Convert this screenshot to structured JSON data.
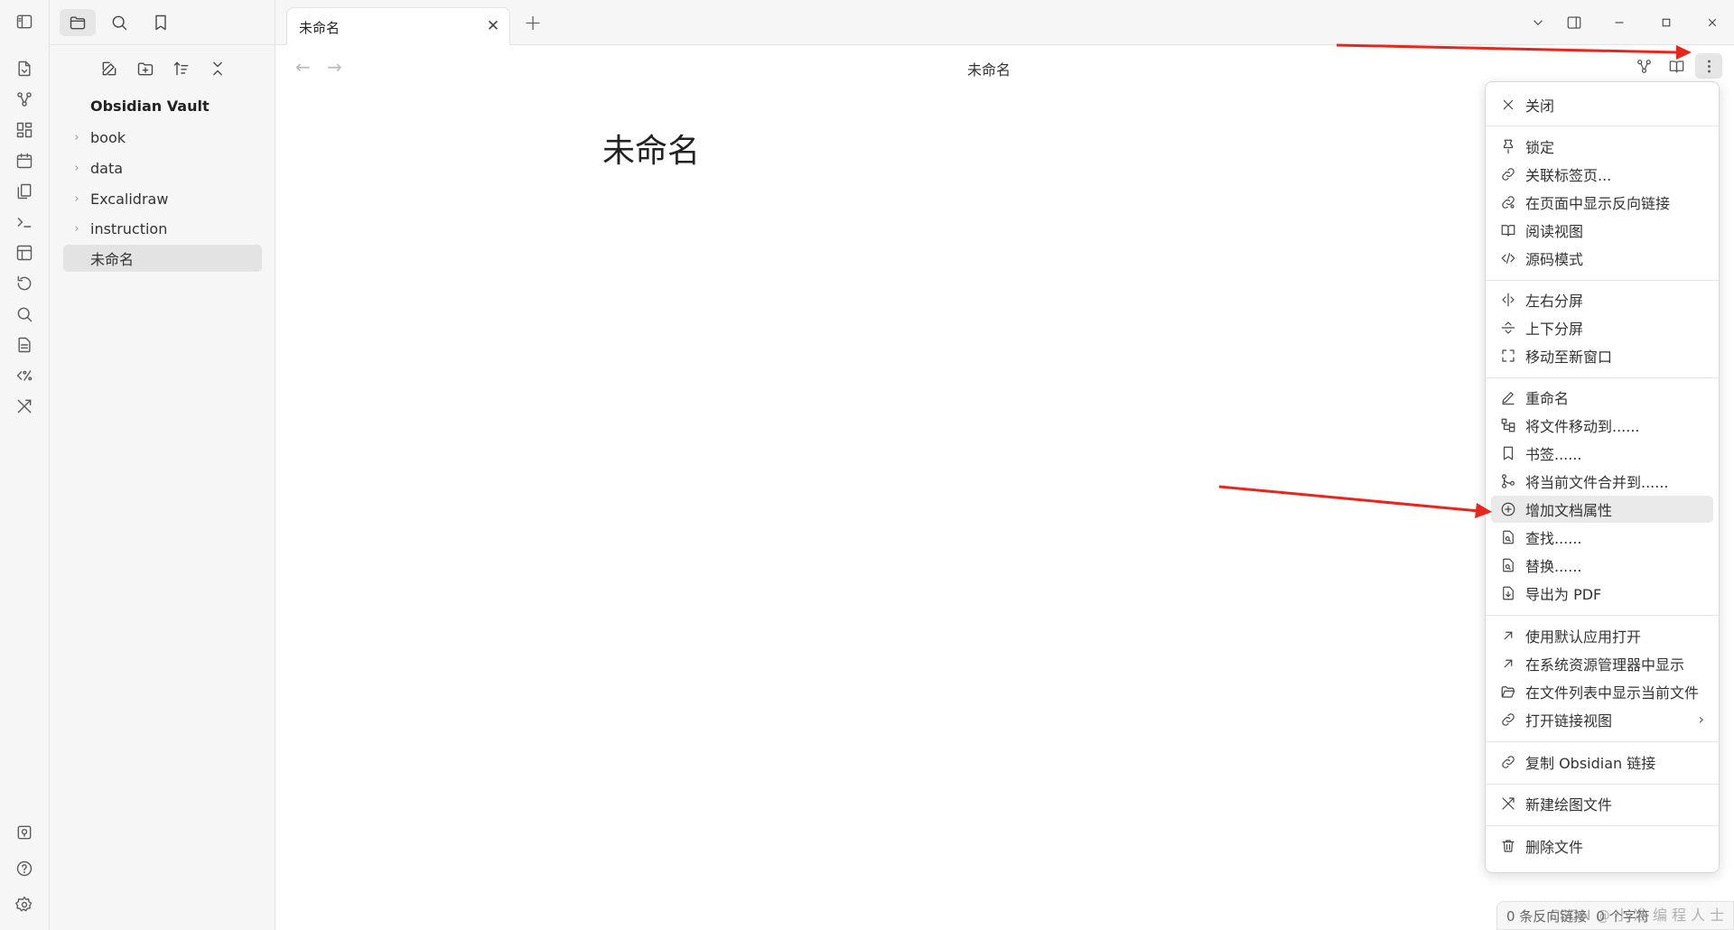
{
  "sidebar": {
    "vault_name": "Obsidian Vault",
    "tree": [
      {
        "label": "book",
        "type": "folder"
      },
      {
        "label": "data",
        "type": "folder"
      },
      {
        "label": "Excalidraw",
        "type": "folder"
      },
      {
        "label": "instruction",
        "type": "folder"
      },
      {
        "label": "未命名",
        "type": "file",
        "active": true
      }
    ]
  },
  "tabbar": {
    "tab_title": "未命名",
    "close_glyph": "✕",
    "new_tab_glyph": "+"
  },
  "view": {
    "header_title": "未命名",
    "back_glyph": "←",
    "forward_glyph": "→",
    "doc_title": "未命名"
  },
  "menu": {
    "items": [
      {
        "label": "关闭",
        "icon": "close-icon"
      },
      {
        "label": "锁定",
        "icon": "pin-icon"
      },
      {
        "label": "关联标签页...",
        "icon": "link-icon"
      },
      {
        "label": "在页面中显示反向链接",
        "icon": "backlink-icon"
      },
      {
        "label": "阅读视图",
        "icon": "book-open-icon"
      },
      {
        "label": "源码模式",
        "icon": "code-icon"
      },
      {
        "label": "左右分屏",
        "icon": "split-vertical-icon"
      },
      {
        "label": "上下分屏",
        "icon": "split-horizontal-icon"
      },
      {
        "label": "移动至新窗口",
        "icon": "maximize-icon"
      },
      {
        "label": "重命名",
        "icon": "pencil-icon"
      },
      {
        "label": "将文件移动到......",
        "icon": "folder-tree-icon"
      },
      {
        "label": "书签......",
        "icon": "bookmark-icon"
      },
      {
        "label": "将当前文件合并到......",
        "icon": "git-merge-icon"
      },
      {
        "label": "增加文档属性",
        "icon": "plus-circle-icon",
        "highlighted": true
      },
      {
        "label": "查找......",
        "icon": "file-search-icon"
      },
      {
        "label": "替换......",
        "icon": "file-replace-icon"
      },
      {
        "label": "导出为 PDF",
        "icon": "file-export-icon"
      },
      {
        "label": "使用默认应用打开",
        "icon": "arrow-up-right-icon"
      },
      {
        "label": "在系统资源管理器中显示",
        "icon": "arrow-up-right-icon"
      },
      {
        "label": "在文件列表中显示当前文件",
        "icon": "folder-open-icon"
      },
      {
        "label": "打开链接视图",
        "icon": "link-icon",
        "submenu": true
      },
      {
        "label": "复制 Obsidian 链接",
        "icon": "link-icon"
      },
      {
        "label": "新建绘图文件",
        "icon": "excalidraw-icon"
      },
      {
        "label": "删除文件",
        "icon": "trash-icon"
      }
    ],
    "submenu_glyph": "›"
  },
  "statusbar": {
    "backlinks": "0 条反向链接",
    "extra": "0 个字符"
  },
  "watermark": "CSDN @ 小 准 编 程 人 士",
  "colors": {
    "accent_arrow": "#e8261c",
    "highlight_bg": "#eaeaea"
  }
}
